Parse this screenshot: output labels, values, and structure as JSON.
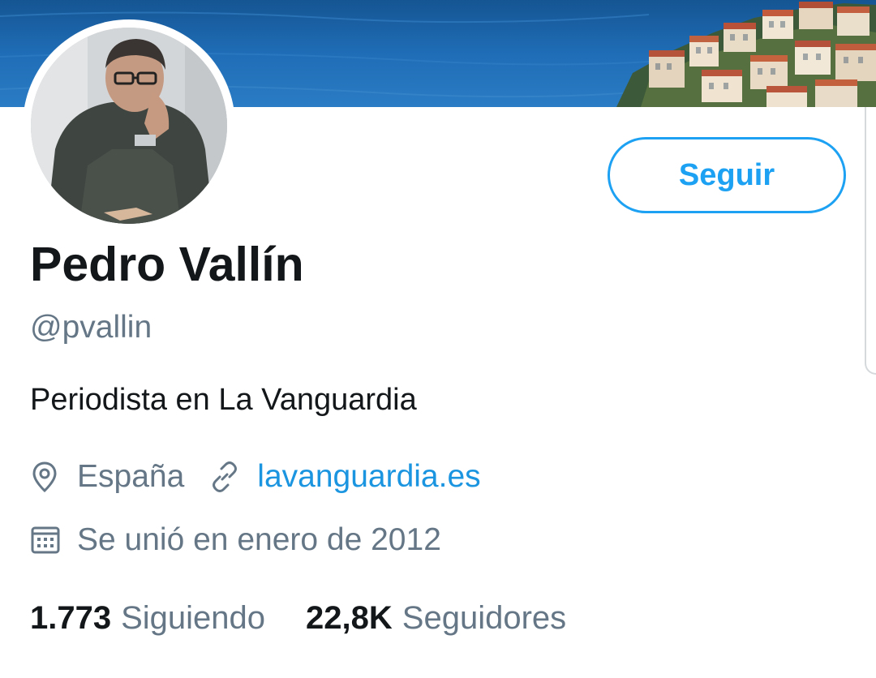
{
  "profile": {
    "name": "Pedro Vallín",
    "handle": "@pvallin",
    "bio": "Periodista en La Vanguardia",
    "location": "España",
    "website": "lavanguardia.es",
    "joined": "Se unió en enero de 2012"
  },
  "actions": {
    "follow_label": "Seguir"
  },
  "stats": {
    "following_count": "1.773",
    "following_label": "Siguiendo",
    "followers_count": "22,8K",
    "followers_label": "Seguidores"
  },
  "icons": {
    "location": "location-pin-icon",
    "website": "link-icon",
    "joined": "calendar-icon"
  },
  "colors": {
    "accent": "#1da1f2",
    "link": "#1b95e0",
    "text_primary": "#14171a",
    "text_secondary": "#657786"
  }
}
